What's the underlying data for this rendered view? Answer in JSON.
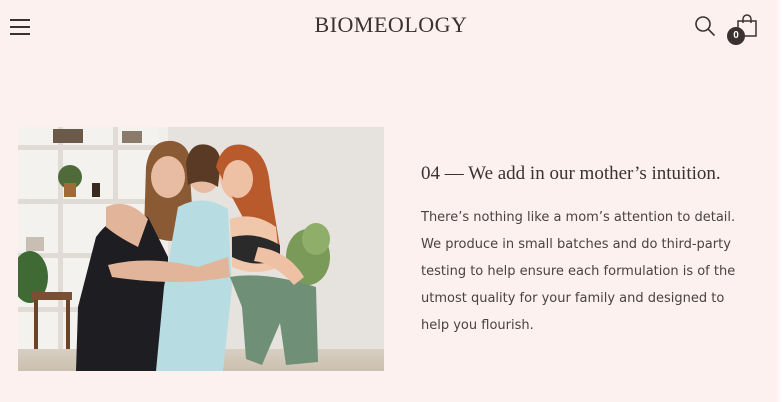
{
  "header": {
    "brand": "BIOMEOLOGY",
    "menu_icon": "hamburger-menu-icon",
    "search_icon": "search-icon",
    "cart_icon": "shopping-bag-icon",
    "cart_count": "0"
  },
  "feature": {
    "image_alt": "Three smiling women in athletic wear hugging in a bright room",
    "heading": "04 — We add in our mother’s intuition.",
    "body": "There’s nothing like a mom’s attention to detail. We produce in small batches and do third-party testing to help ensure each formulation is of the utmost quality for your family and designed to help you flourish."
  },
  "colors": {
    "background": "#fdf1ef",
    "text": "#3a3231",
    "badge": "#3a3231"
  }
}
